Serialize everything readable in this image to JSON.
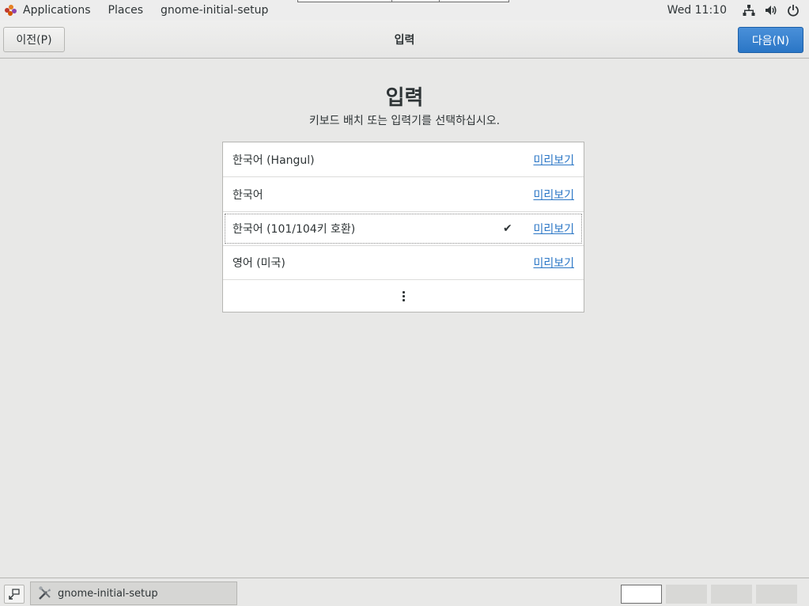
{
  "top_panel": {
    "applications_label": "Applications",
    "places_label": "Places",
    "app_name": "gnome-initial-setup",
    "clock": "Wed 11:10",
    "icons": [
      "network-icon",
      "volume-icon",
      "power-icon"
    ]
  },
  "header": {
    "prev_label": "이전(P)",
    "title": "입력",
    "next_label": "다음(N)"
  },
  "main": {
    "heading": "입력",
    "subtitle": "키보드 배치 또는 입력기를 선택하십시오.",
    "inputs": [
      {
        "label": "한국어 (Hangul)",
        "preview": "미리보기",
        "selected": false
      },
      {
        "label": "한국어",
        "preview": "미리보기",
        "selected": false
      },
      {
        "label": "한국어 (101/104키 호환)",
        "preview": "미리보기",
        "selected": true
      },
      {
        "label": "영어 (미국)",
        "preview": "미리보기",
        "selected": false
      }
    ],
    "more_icon": "more-vertical-icon"
  },
  "bottom_panel": {
    "task_label": "gnome-initial-setup",
    "workspace_count": 4,
    "active_workspace": 1
  },
  "colors": {
    "accent": "#2a76c6",
    "background": "#e8e8e7"
  }
}
